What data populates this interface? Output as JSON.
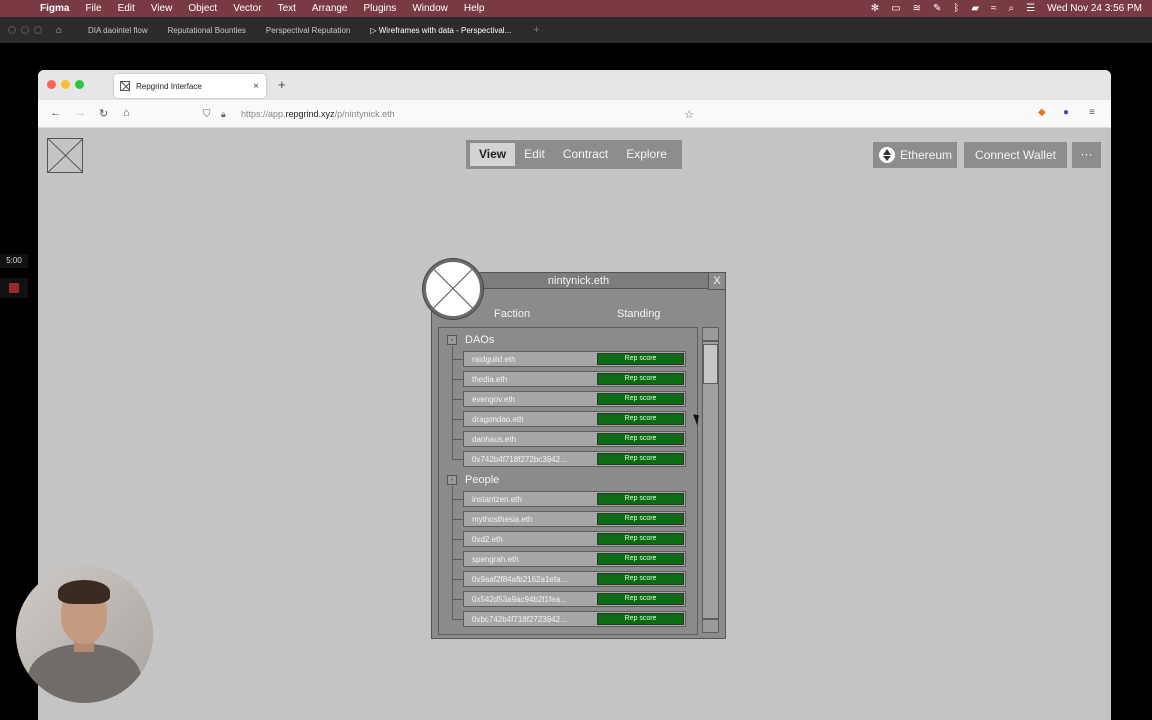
{
  "menubar": {
    "apple": "",
    "items": [
      "Figma",
      "File",
      "Edit",
      "View",
      "Object",
      "Vector",
      "Text",
      "Arrange",
      "Plugins",
      "Window",
      "Help"
    ],
    "datetime": "Wed Nov 24  3:56 PM"
  },
  "figma_tabs": {
    "tabs": [
      "DIA daointel flow",
      "Reputational Bounties",
      "Perspectival Reputation",
      "Wireframes with data - Perspectival..."
    ],
    "active_index": 3,
    "new_tab": "+"
  },
  "recording": {
    "timer": "5:00"
  },
  "browser": {
    "tab_title": "Repgrind Interface",
    "tab_close": "×",
    "new_tab": "+",
    "url_prefix": "https://app.",
    "url_domain": "repgrind.xyz",
    "url_path": "/p/nintynick.eth"
  },
  "page": {
    "nav": [
      "View",
      "Edit",
      "Contract",
      "Explore"
    ],
    "nav_active": "View",
    "network_label": "Ethereum",
    "wallet_label": "Connect Wallet",
    "more_label": "···"
  },
  "profile": {
    "title": "nintynick.eth",
    "close_label": "X",
    "col_faction": "Faction",
    "col_standing": "Standing",
    "groups": [
      {
        "name": "DAOs",
        "toggle": "-",
        "rows": [
          {
            "name": "raidguild.eth",
            "score": "Rep score"
          },
          {
            "name": "thedia.eth",
            "score": "Rep score"
          },
          {
            "name": "evengov.eth",
            "score": "Rep score"
          },
          {
            "name": "dragondao.eth",
            "score": "Rep score"
          },
          {
            "name": "daohaus.eth",
            "score": "Rep score"
          },
          {
            "name": "0x742b4f718f272bc3942...",
            "score": "Rep score"
          }
        ]
      },
      {
        "name": "People",
        "toggle": "-",
        "rows": [
          {
            "name": "instantzen.eth",
            "score": "Rep score"
          },
          {
            "name": "mythosthesia.eth",
            "score": "Rep score"
          },
          {
            "name": "0xd2.eth",
            "score": "Rep score"
          },
          {
            "name": "spengrah.eth",
            "score": "Rep score"
          },
          {
            "name": "0x9aaf2f84afb2162a1efa...",
            "score": "Rep score"
          },
          {
            "name": "0x542d53a9ac94b2f1fea...",
            "score": "Rep score"
          },
          {
            "name": "0xbc742b4f718f2723942...",
            "score": "Rep score"
          }
        ]
      }
    ]
  },
  "colors": {
    "menubar": "#7a3a44",
    "rep_score": "#0a6b12",
    "panel": "#8b8b8b",
    "page_bg": "#c4c4c4"
  },
  "icons": [
    "apple-icon",
    "home-icon",
    "shield-icon",
    "lock-icon",
    "star-icon",
    "metamask-icon",
    "extension-icon",
    "hamburger-menu-icon",
    "ethereum-icon",
    "placeholder-logo-icon",
    "avatar-placeholder-icon"
  ]
}
